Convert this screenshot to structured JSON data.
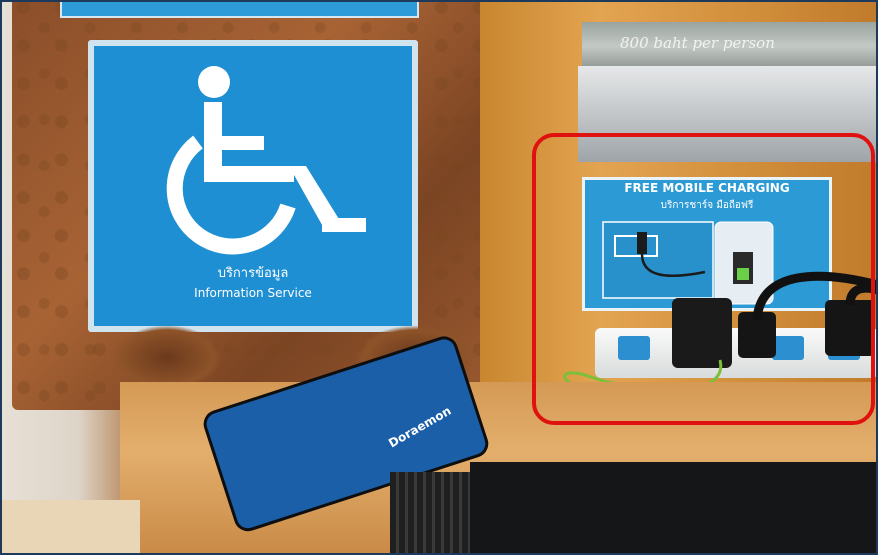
{
  "scene": {
    "accessibility_sign": {
      "thai_text": "บริการข้อมูล",
      "english_text": "Information Service",
      "icon": "wheelchair-icon"
    },
    "price_plate": {
      "text": "800 baht per person"
    },
    "charging_sign": {
      "title": "FREE MOBILE CHARGING",
      "thai_text": "บริการชาร์จ มือถือฟรี"
    },
    "power_bank": {
      "text": "Doraemon"
    },
    "highlight": {
      "color": "#e0120f"
    },
    "colors": {
      "sign_blue": "#1e8fd2",
      "wood": "#d49a55",
      "highlight_red": "#e0120f"
    }
  }
}
